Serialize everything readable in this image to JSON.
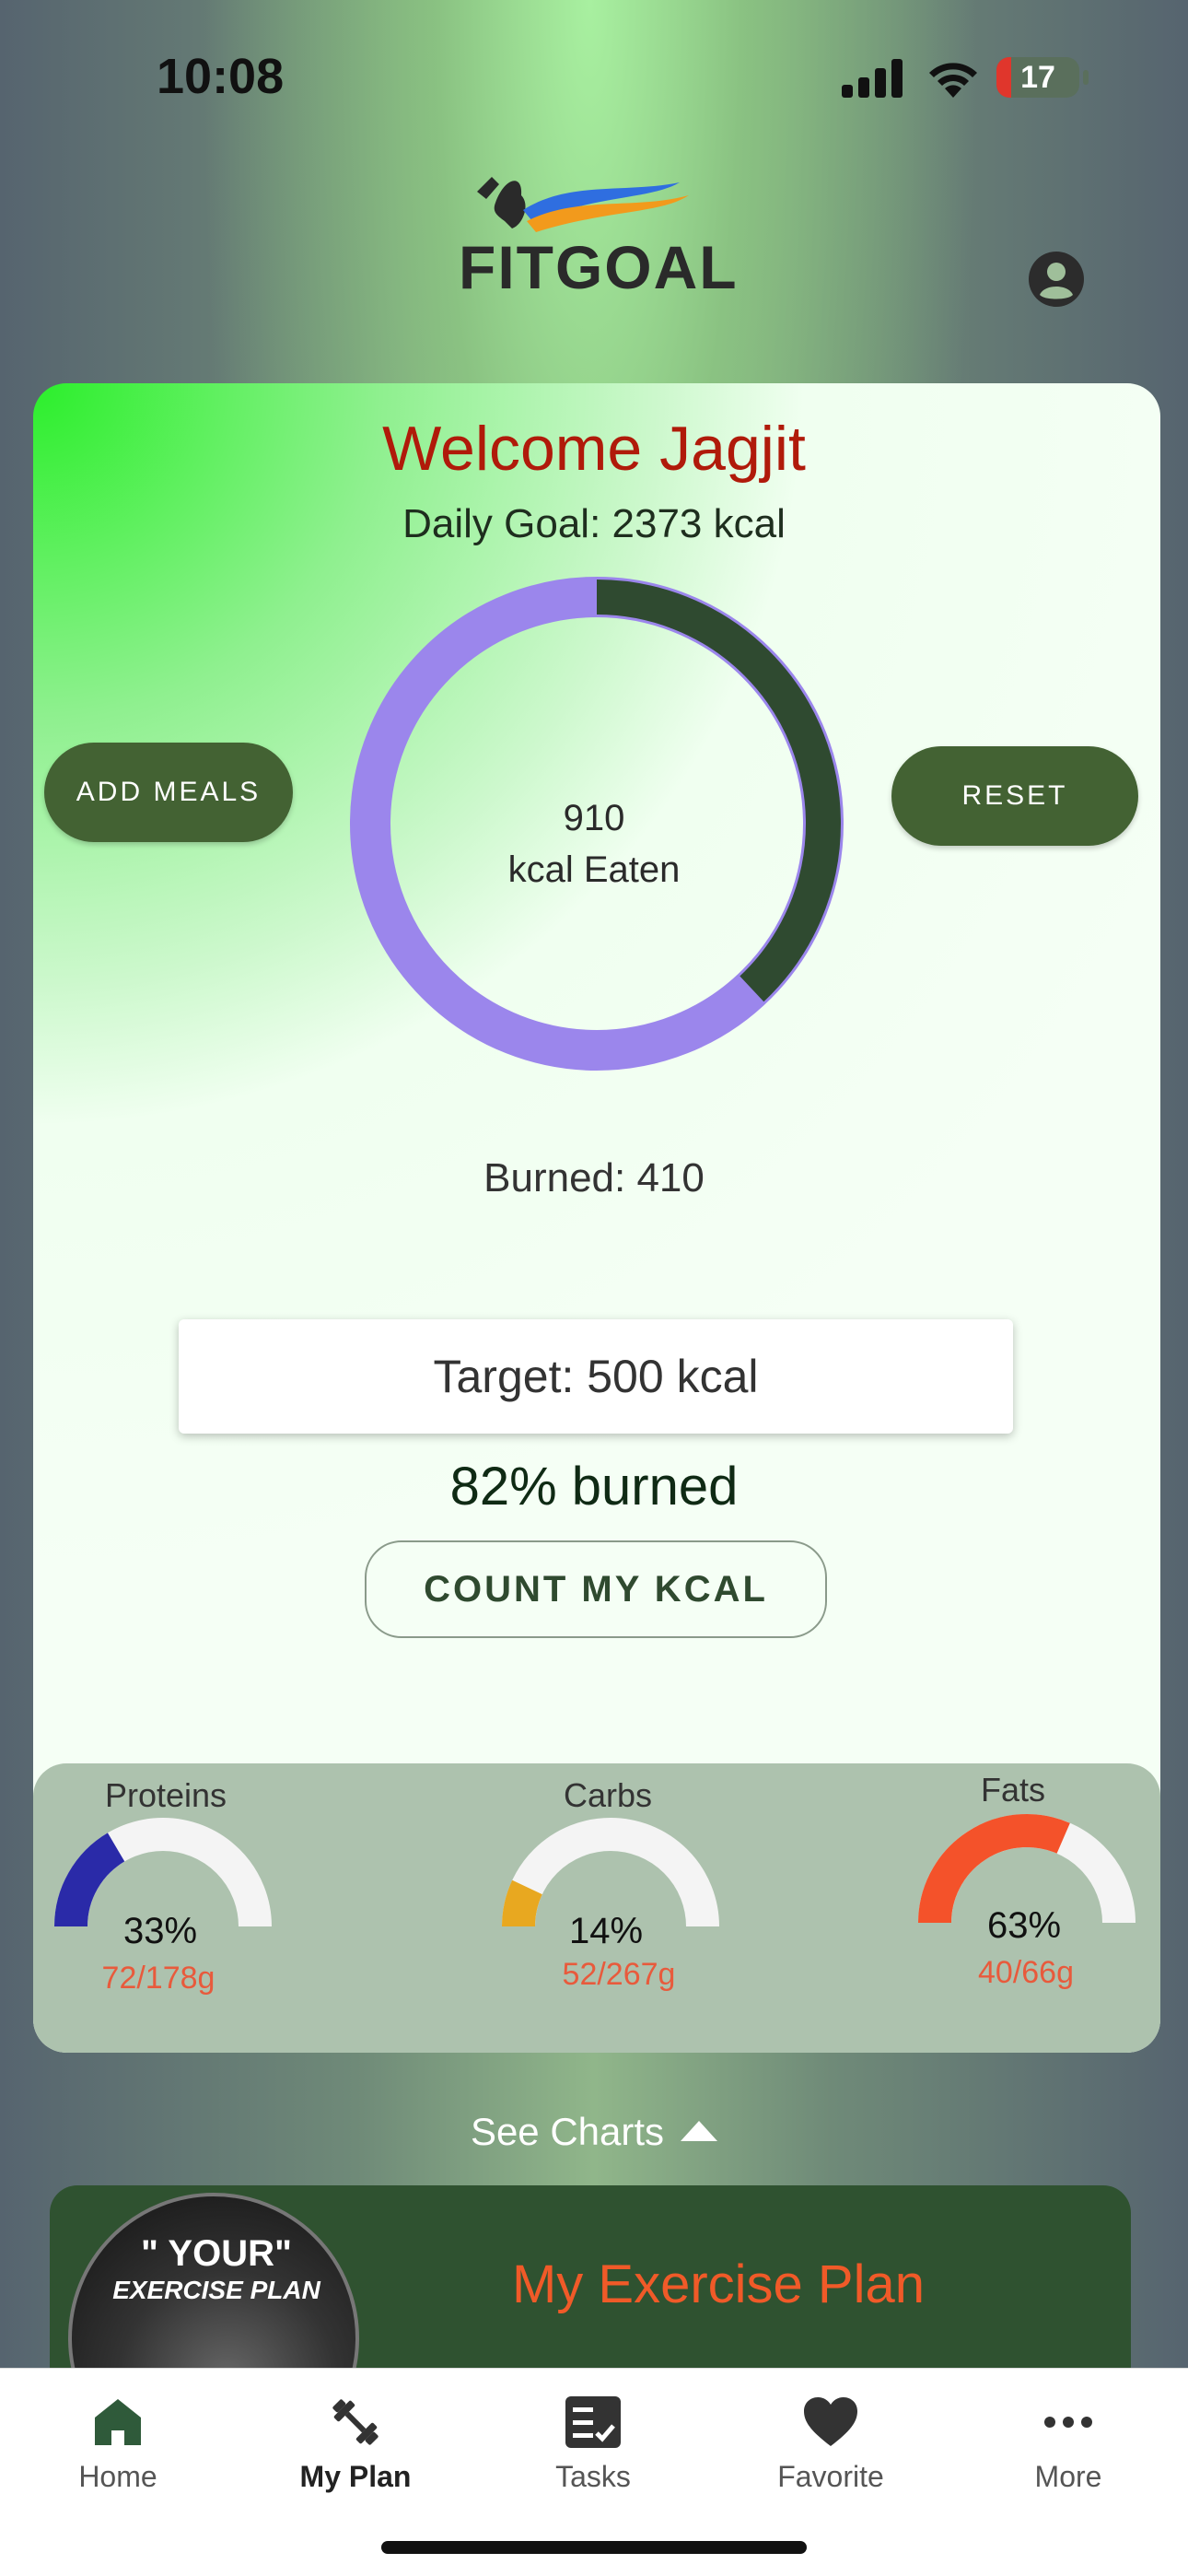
{
  "status_bar": {
    "time": "10:08",
    "battery": "17"
  },
  "header": {
    "app_name": "FITGOAL"
  },
  "dashboard": {
    "welcome": "Welcome Jagjit",
    "daily_goal": "Daily Goal: 2373 kcal",
    "eaten_value": "910",
    "eaten_label": "kcal Eaten",
    "eaten_fraction": 0.38,
    "add_meals_label": "ADD MEALS",
    "reset_label": "RESET",
    "burned": "Burned: 410",
    "target": "Target: 500 kcal",
    "burned_pct": "82% burned",
    "count_button": "COUNT MY KCAL",
    "colors": {
      "ring_track": "#9b86ec",
      "ring_fill": "#2f4a30",
      "button": "#436233"
    }
  },
  "macros": [
    {
      "name": "Proteins",
      "percent": "33%",
      "grams": "72/178g",
      "fraction": 0.33,
      "color": "#2a2aa8"
    },
    {
      "name": "Carbs",
      "percent": "14%",
      "grams": "52/267g",
      "fraction": 0.14,
      "color": "#e8a820"
    },
    {
      "name": "Fats",
      "percent": "63%",
      "grams": "40/66g",
      "fraction": 0.63,
      "color": "#f4522a"
    }
  ],
  "see_charts": "See Charts",
  "exercise": {
    "thumb_line1": "\" YOUR\"",
    "thumb_line2": "EXERCISE PLAN",
    "title": "My Exercise Plan"
  },
  "tabs": [
    {
      "label": "Home",
      "icon": "home-icon"
    },
    {
      "label": "My Plan",
      "icon": "dumbbell-icon",
      "active": true
    },
    {
      "label": "Tasks",
      "icon": "tasks-icon"
    },
    {
      "label": "Favorite",
      "icon": "heart-icon"
    },
    {
      "label": "More",
      "icon": "more-icon"
    }
  ]
}
